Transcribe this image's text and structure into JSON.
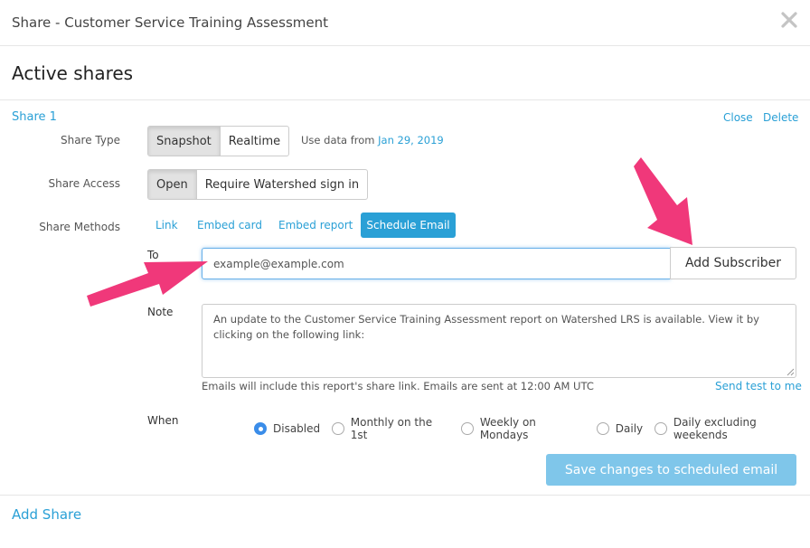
{
  "modal": {
    "title": "Share - Customer Service Training Assessment"
  },
  "heading": "Active shares",
  "share": {
    "name": "Share 1",
    "close_label": "Close",
    "delete_label": "Delete",
    "type": {
      "label": "Share Type",
      "options": [
        "Snapshot",
        "Realtime"
      ],
      "selected": "Snapshot",
      "use_data_prefix": "Use data from",
      "use_data_date": "Jan 29, 2019"
    },
    "access": {
      "label": "Share Access",
      "options": [
        "Open",
        "Require Watershed sign in"
      ],
      "selected": "Open"
    },
    "methods": {
      "label": "Share Methods",
      "items": [
        "Link",
        "Embed card",
        "Embed report",
        "Schedule Email"
      ],
      "selected": "Schedule Email"
    },
    "email": {
      "to_label": "To",
      "to_value": "example@example.com",
      "add_subscriber_label": "Add Subscriber",
      "note_label": "Note",
      "note_value": "An update to the Customer Service Training Assessment report on Watershed LRS is available. View it by clicking on the following link:",
      "help_text": "Emails will include this report's share link. Emails are sent at 12:00 AM UTC",
      "send_test_label": "Send test to me",
      "when_label": "When",
      "when_options": [
        "Disabled",
        "Monthly on the 1st",
        "Weekly on Mondays",
        "Daily",
        "Daily excluding weekends"
      ],
      "when_selected": "Disabled",
      "save_label": "Save changes to scheduled email"
    }
  },
  "add_share_label": "Add Share",
  "colors": {
    "accent": "#2aa0d6",
    "save_button": "#7fc6ea",
    "annotation_arrow": "#f0387a"
  },
  "icons": {
    "close": "close-icon",
    "resize": "resize-grip-icon",
    "arrows": "annotation-arrow-icon"
  }
}
